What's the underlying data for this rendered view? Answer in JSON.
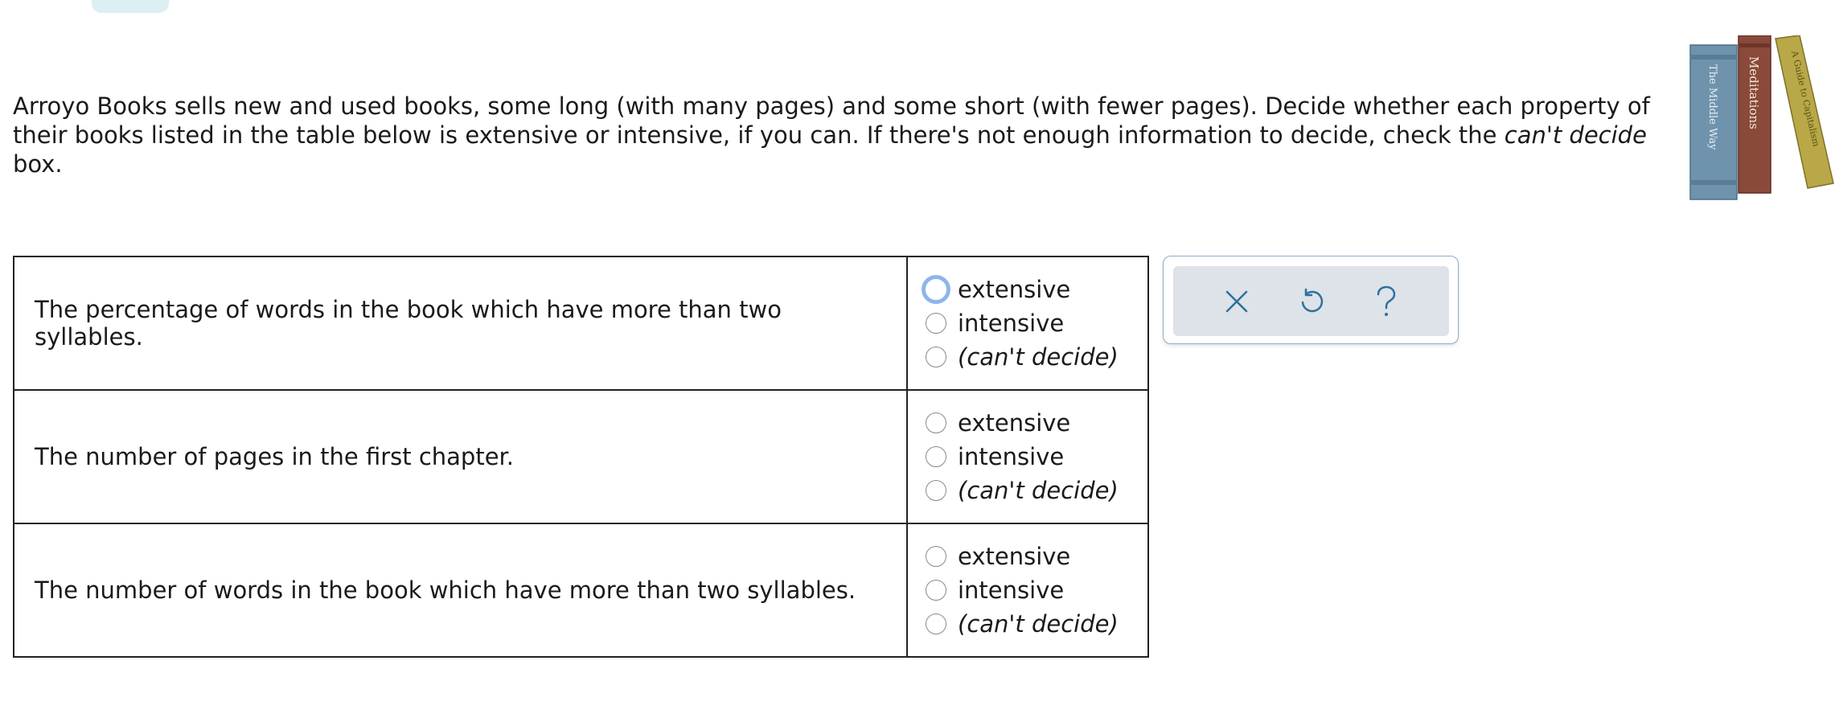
{
  "prompt": {
    "text_before": "Arroyo Books sells new and used books, some long (with many pages) and some short (with fewer pages). Decide whether each property of their books listed in the table below is extensive or intensive, if you can. If there's not enough information to decide, check the ",
    "emphasis": "can't decide",
    "text_after": " box."
  },
  "illustration": {
    "book_titles": [
      "The Middle Way",
      "Meditations",
      "A Guide to Capitalism"
    ]
  },
  "options": {
    "extensive": "extensive",
    "intensive": "intensive",
    "cant_decide": "(can't decide)"
  },
  "rows": [
    {
      "property": "The percentage of words in the book which have more than two syllables."
    },
    {
      "property": "The number of pages in the first chapter."
    },
    {
      "property": "The number of words in the book which have more than two syllables."
    }
  ],
  "toolbar": {
    "clear_icon": "close-icon",
    "undo_icon": "undo-icon",
    "help_icon": "help-icon"
  },
  "colors": {
    "icon": "#2f6f9f",
    "focus_ring": "#8fb5ea",
    "toolbar_bg": "#dde3e8",
    "book_blue": "#6f93ad",
    "book_brown": "#8a4a3a",
    "book_gold": "#b8a848"
  }
}
